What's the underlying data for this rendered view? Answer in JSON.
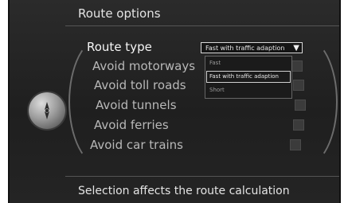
{
  "header": {
    "title": "Route options"
  },
  "options": [
    {
      "label": "Route type"
    },
    {
      "label": "Avoid motorways"
    },
    {
      "label": "Avoid toll roads"
    },
    {
      "label": "Avoid tunnels"
    },
    {
      "label": "Avoid ferries"
    },
    {
      "label": "Avoid car trains"
    }
  ],
  "route_type_select": {
    "value": "Fast with traffic adaption",
    "options": [
      "Fast",
      "Fast with traffic adaption",
      "Short"
    ]
  },
  "footer": {
    "text": "Selection affects the route calculation"
  },
  "icons": {
    "knob": "navigation-compass-icon",
    "caret": "caret-down-icon"
  }
}
